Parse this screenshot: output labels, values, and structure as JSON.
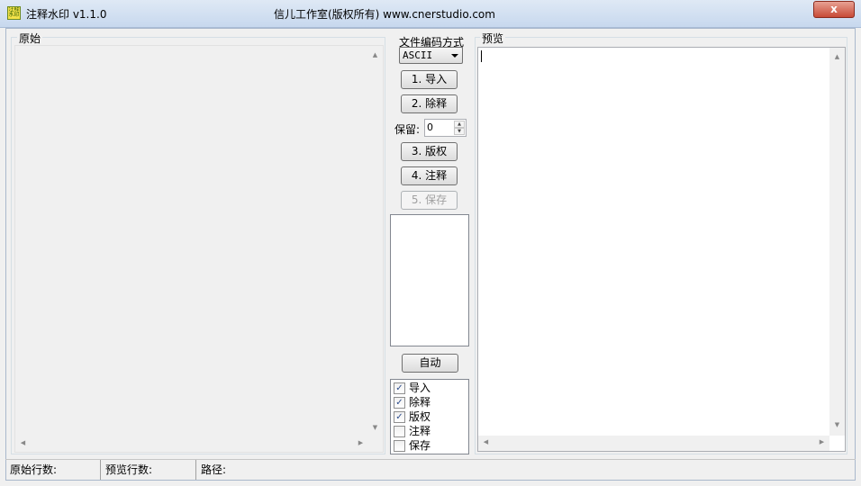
{
  "window": {
    "title": "注释水印 v1.1.0",
    "center_title": "信儿工作室(版权所有) www.cnerstudio.com",
    "close_symbol": "x",
    "icon_text": "注释水印"
  },
  "original_pane": {
    "label": "原始",
    "content": ""
  },
  "preview_pane": {
    "label": "预览",
    "content": ""
  },
  "controls": {
    "encoding_label": "文件编码方式",
    "encoding_value": "ASCII",
    "import_label": "1. 导入",
    "remove_label": "2. 除释",
    "keep_label": "保留:",
    "keep_value": "0",
    "copyright_label": "3. 版权",
    "annotate_label": "4. 注释",
    "save_label": "5. 保存",
    "auto_label": "自动"
  },
  "checklist": [
    {
      "label": "导入",
      "checked": true
    },
    {
      "label": "除释",
      "checked": true
    },
    {
      "label": "版权",
      "checked": true
    },
    {
      "label": "注释",
      "checked": false
    },
    {
      "label": "保存",
      "checked": false
    }
  ],
  "statusbar": {
    "original_lines_label": "原始行数:",
    "preview_lines_label": "预览行数:",
    "path_label": "路径:"
  },
  "colors": {
    "accent_check": "#2d4d8c",
    "close_button": "#c74a36"
  }
}
